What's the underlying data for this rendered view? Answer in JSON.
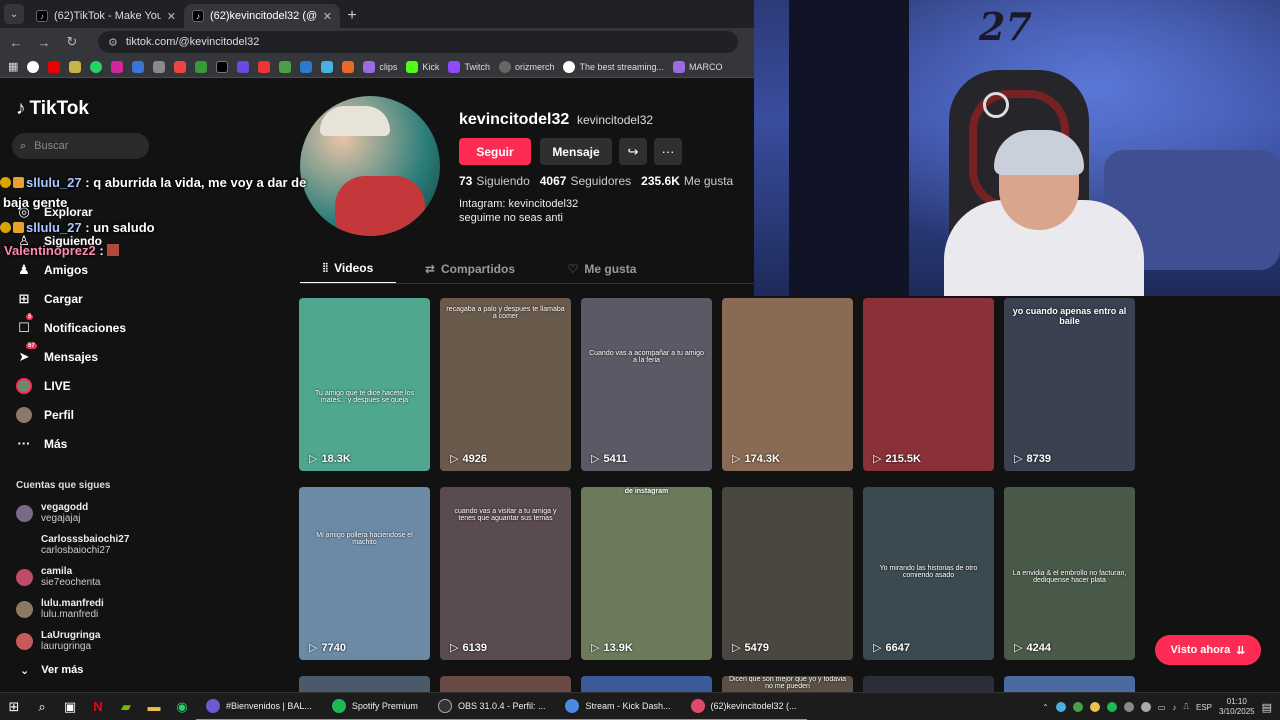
{
  "browser": {
    "tabs": [
      {
        "title": "(62)TikTok - Make Your Day",
        "active": false
      },
      {
        "title": "(62)kevincitodel32 (@kevincito",
        "active": true
      }
    ],
    "url": "tiktok.com/@kevincitodel32",
    "bookmarks": [
      "clips",
      "Kick",
      "Twitch",
      "orizmerch",
      "The best streaming...",
      "MARCO"
    ]
  },
  "sidebar": {
    "logo": "TikTok",
    "search_placeholder": "Buscar",
    "nav": [
      "Explorar",
      "Siguiendo",
      "Amigos",
      "Cargar",
      "Notificaciones",
      "Mensajes",
      "LIVE",
      "Perfil",
      "Más"
    ],
    "notif_badge": "5",
    "msg_badge": "57",
    "following_title": "Cuentas que sigues",
    "accounts": [
      {
        "name": "vegagodd",
        "handle": "vegajajaj",
        "color": "#7a6a8a"
      },
      {
        "name": "Carlosssbaiochi27",
        "handle": "carlosbaiochi27",
        "color": "#121212"
      },
      {
        "name": "camila",
        "handle": "sie7eochenta",
        "color": "#c04a6a"
      },
      {
        "name": "lulu.manfredi",
        "handle": "lulu.manfredi",
        "color": "#8a7a60"
      },
      {
        "name": "LaUrugringa",
        "handle": "laurugringa",
        "color": "#c45a5a"
      }
    ],
    "see_more": "Ver más"
  },
  "chat": [
    {
      "name": "sllulu_27",
      "text": " : q aburrida la vida, me voy a dar de",
      "cont": "baja gente"
    },
    {
      "name": "sllulu_27",
      "text": " : un saludo"
    },
    {
      "name": "Valentinoprez2",
      "text": " : "
    }
  ],
  "profile": {
    "username": "kevincitodel32",
    "nickname": "kevincitodel32",
    "follow_label": "Seguir",
    "message_label": "Mensaje",
    "following_count": "73",
    "following_label": "Siguiendo",
    "followers_count": "4067",
    "followers_label": "Seguidores",
    "likes_count": "235.6K",
    "likes_label": "Me gusta",
    "bio_line1": "Intagram: kevincitodel32",
    "bio_line2": "seguime no seas anti",
    "tabs": [
      "Videos",
      "Compartidos",
      "Me gusta"
    ]
  },
  "videos": [
    {
      "views": "18.3K",
      "caption": "Tu amigo que te dice hacete los mates... y despues se queja",
      "bg": "#4fa78f"
    },
    {
      "views": "4926",
      "top": "recagaba a palo y despues te llamaba a comer",
      "bg": "#6a5a4c"
    },
    {
      "views": "5411",
      "caption": "Cuando vas a acompañar a tu amigo a la feria",
      "bg": "#5a5a66"
    },
    {
      "views": "174.3K",
      "bg": "#8a6a54"
    },
    {
      "views": "215.5K",
      "bg": "#8a3038"
    },
    {
      "views": "8739",
      "top": "yo cuando apenas entro al baile",
      "bg": "#3a4252"
    },
    {
      "views": "7740",
      "caption": "Mi amigo pollera haciendose el machito",
      "bg": "#6a8aa6"
    },
    {
      "views": "6139",
      "top": "cuando vas a visitar a tu amiga y tenes que aguantar sus temas",
      "bg": "#5a4a52"
    },
    {
      "views": "13.9K",
      "top": "de instagram",
      "bg": "#6a7a5a"
    },
    {
      "views": "5479",
      "bg": "#4a4640"
    },
    {
      "views": "6647",
      "caption": "Yo mirando las historias de otro comiendo asado",
      "bg": "#3a4a50"
    },
    {
      "views": "4244",
      "caption": "La envidia & el embrollo no facturan, dediquense hacer plata",
      "bg": "#4a5a48"
    }
  ],
  "bottom_row_captions": [
    "",
    "",
    "",
    "Dicen que son mejor que yo y todavia no me pueden",
    "",
    ""
  ],
  "visto_ahora": "Visto ahora",
  "taskbar": {
    "apps": [
      "#Bienvenidos | BAL...",
      "Spotify Premium",
      "OBS 31.0.4 - Perfil: ...",
      "Stream - Kick Dash...",
      "(62)kevincitodel32 (..."
    ],
    "lang": "ESP",
    "time": "01:10",
    "date": "3/10/2025"
  }
}
